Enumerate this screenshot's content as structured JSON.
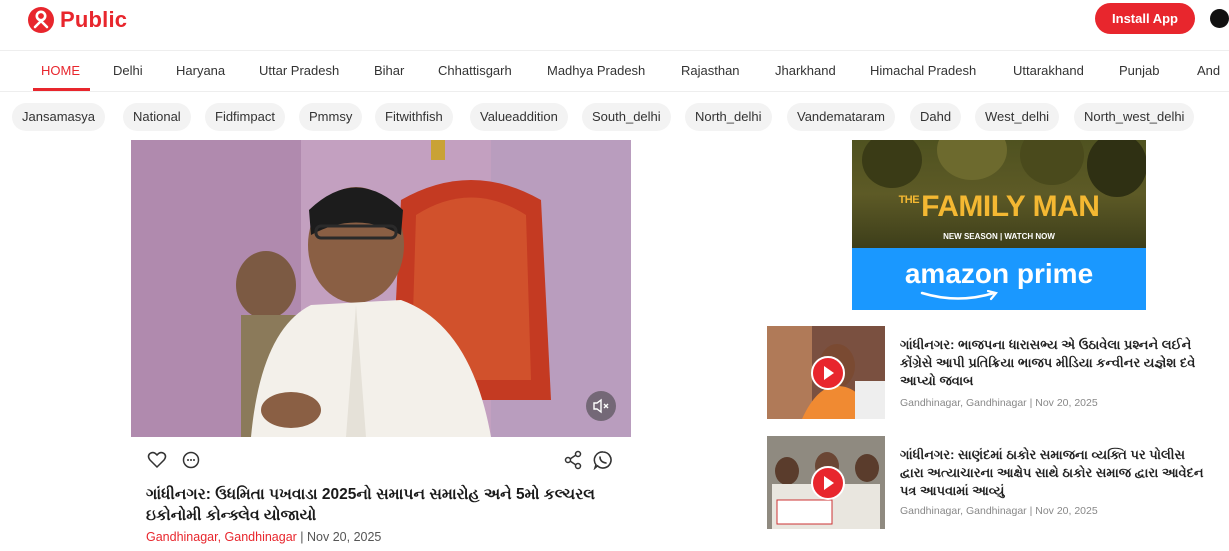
{
  "header": {
    "logo_text": "Public",
    "install_label": "Install App"
  },
  "nav": {
    "items": [
      "HOME",
      "Delhi",
      "Haryana",
      "Uttar Pradesh",
      "Bihar",
      "Chhattisgarh",
      "Madhya Pradesh",
      "Rajasthan",
      "Jharkhand",
      "Himachal Pradesh",
      "Uttarakhand",
      "Punjab",
      "And"
    ]
  },
  "chips": [
    "Jansamasya",
    "National",
    "Fidfimpact",
    "Pmmsy",
    "Fitwithfish",
    "Valueaddition",
    "South_delhi",
    "North_delhi",
    "Vandemataram",
    "Dahd",
    "West_delhi",
    "North_west_delhi"
  ],
  "main_card": {
    "title": "ગાંધીનગર: ઉધમિતા પખવાડા 2025નો સમાપન સમારોહ અને 5મો કલ્ચરલ ઇકોનોમી કોન્ક્લેવ યોજાયો",
    "location": "Gandhinagar, Gandhinagar",
    "date": "| Nov 20, 2025"
  },
  "ad": {
    "the": "THE",
    "title": "FAMILY MAN",
    "subtitle": "NEW SEASON | WATCH NOW",
    "brand": "amazon prime"
  },
  "side_news": [
    {
      "title": "ગાંધીનગર: ભાજપના ધારાસભ્ય એ ઉઠાવેલા પ્રશ્નને લઈને કોંગ્રેસે આપી પ્રતિક્રિયા ભાજપ મીડિયા કન્વીનર યજ્ઞેશ દવે આપ્યો જવાબ",
      "meta": "Gandhinagar, Gandhinagar | Nov 20, 2025"
    },
    {
      "title": "ગાંધીનગર: સાણંદમાં ઠાકોર સમાજના વ્યક્તિ પર પોલીસ દ્વારા અત્યાચારના આક્ષેપ સાથે ઠાકોર સમાજ દ્વારા આવેદન પત્ર આપવામાં આવ્યું",
      "meta": "Gandhinagar, Gandhinagar | Nov 20, 2025"
    }
  ],
  "colors": {
    "brand_red": "#e8262d",
    "ad_blue": "#1a98ff",
    "ad_gold": "#f4b832"
  }
}
